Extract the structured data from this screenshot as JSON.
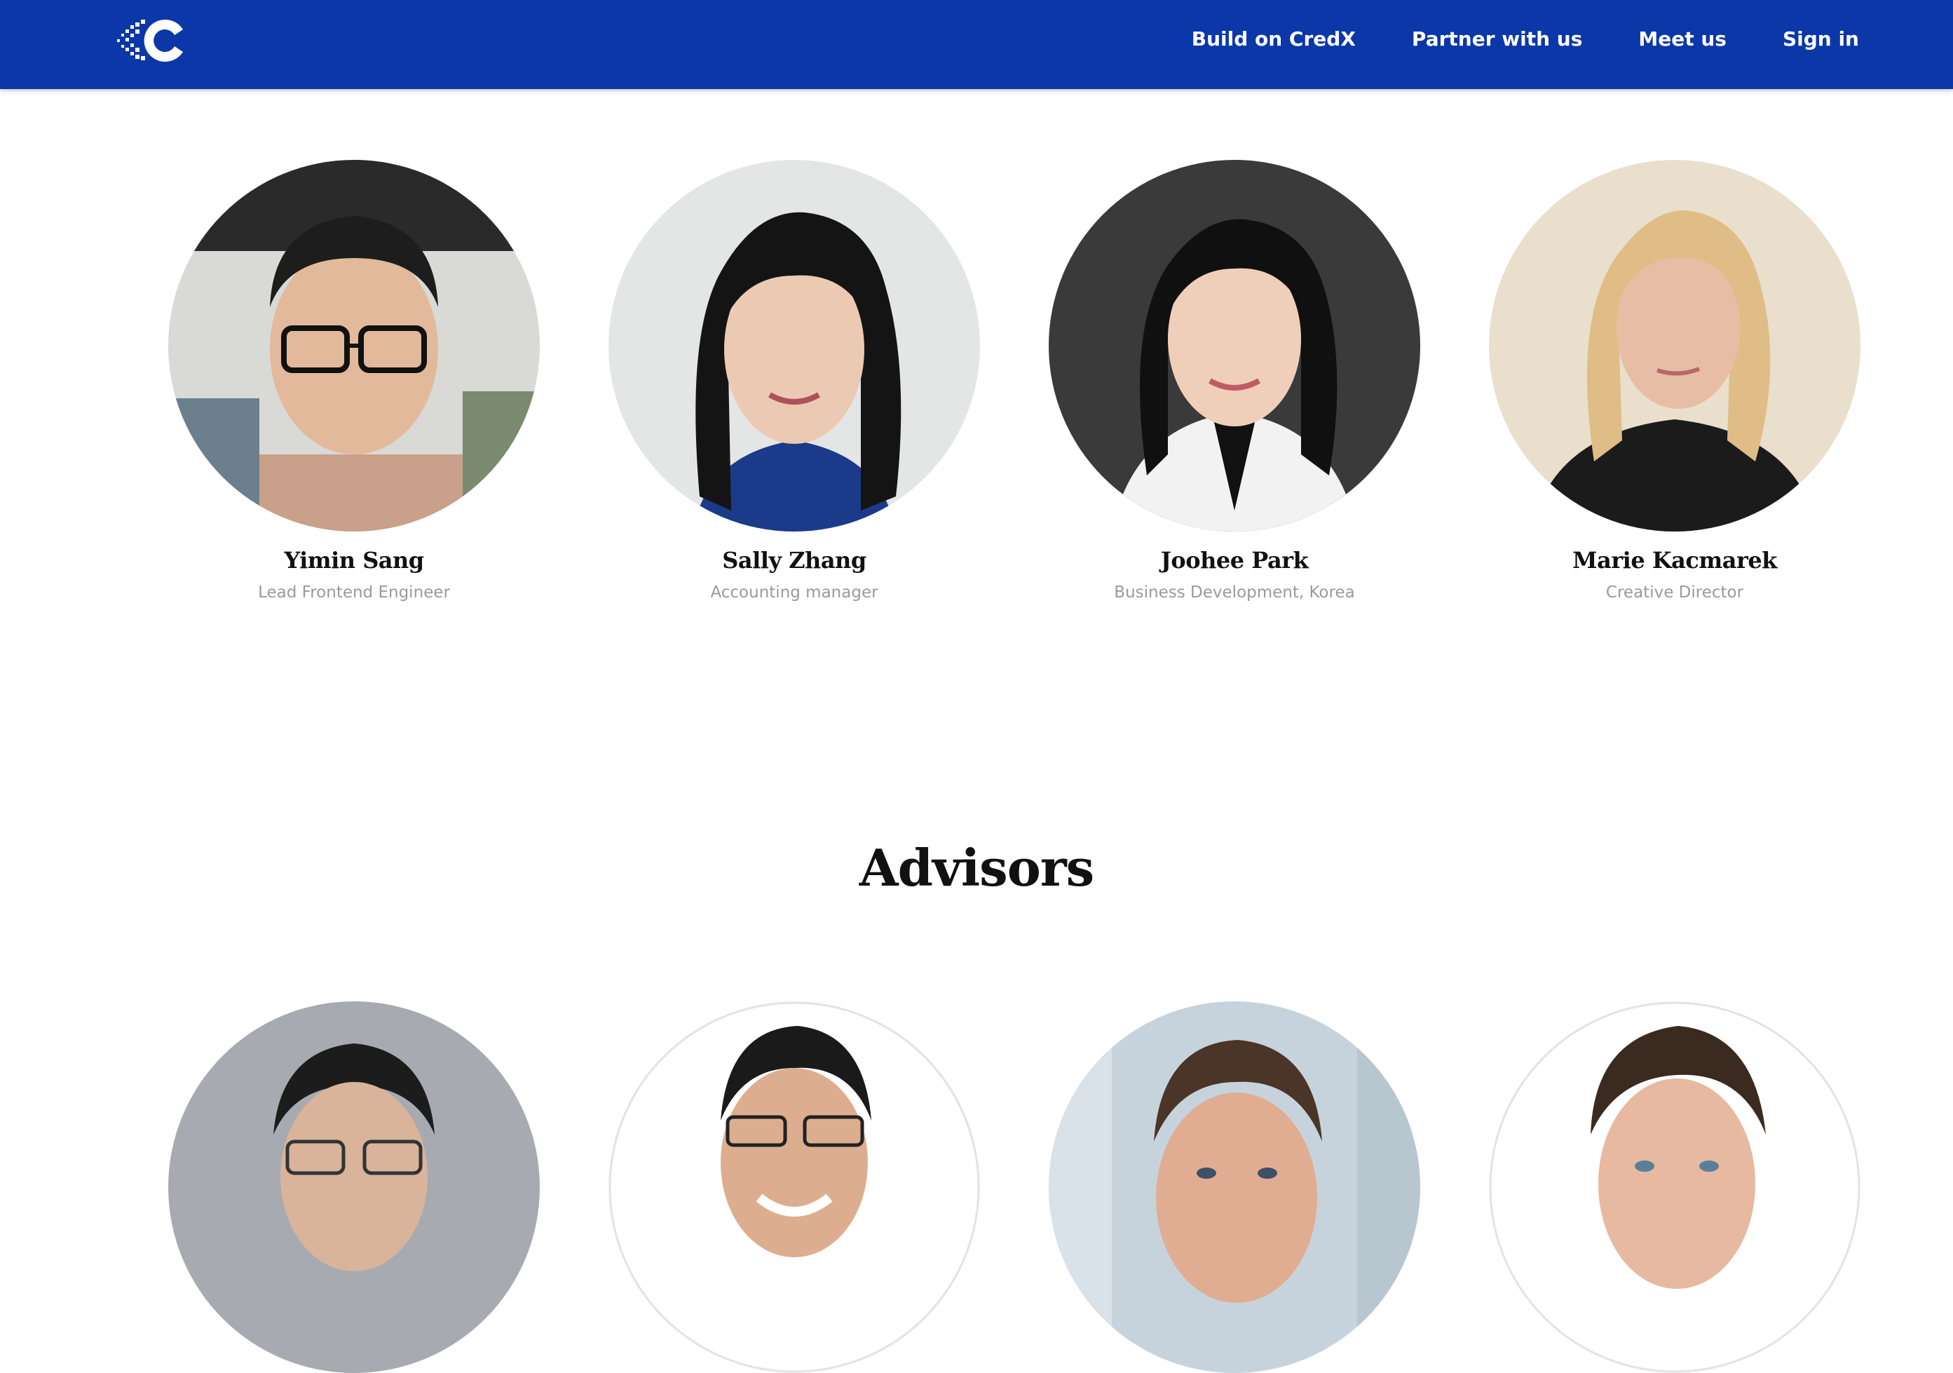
{
  "navbar": {
    "logo_icon": "credx-c-logo-icon",
    "links": [
      {
        "label": "Build on CredX"
      },
      {
        "label": "Partner with us"
      },
      {
        "label": "Meet us"
      },
      {
        "label": "Sign in"
      }
    ]
  },
  "colors": {
    "brand_blue": "#0b37a8",
    "name_text": "#111111",
    "role_text": "#9a9a9a"
  },
  "team": [
    {
      "name": "Yimin Sang",
      "role": "Lead Frontend Engineer"
    },
    {
      "name": "Sally Zhang",
      "role": "Accounting manager"
    },
    {
      "name": "Joohee Park",
      "role": "Business Development, Korea"
    },
    {
      "name": "Marie Kacmarek",
      "role": "Creative Director"
    }
  ],
  "advisors_section": {
    "title": "Advisors"
  }
}
